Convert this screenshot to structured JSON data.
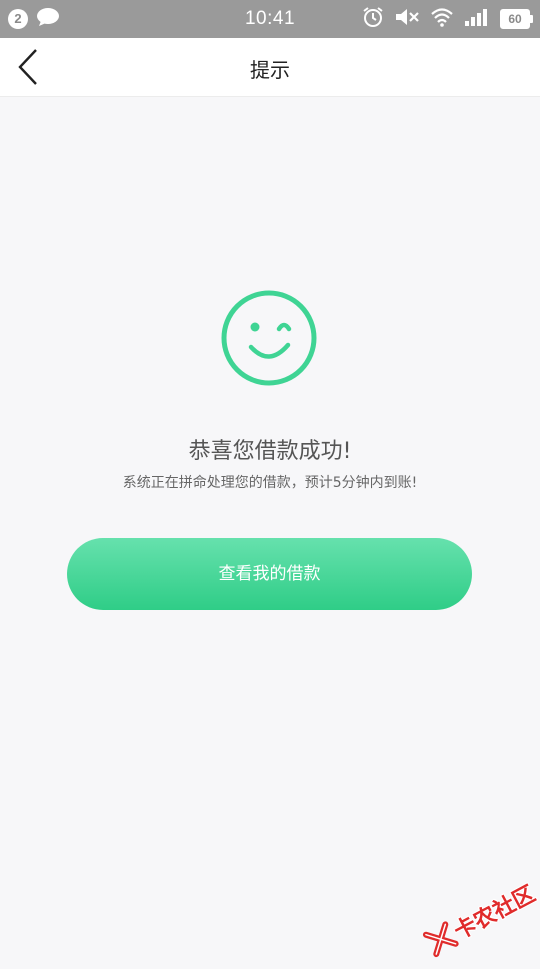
{
  "status_bar": {
    "notification_count": "2",
    "time": "10:41",
    "battery_level": "60"
  },
  "nav": {
    "title": "提示",
    "back_icon": "chevron-left-icon"
  },
  "content": {
    "icon": "wink-smiley-icon",
    "title": "恭喜您借款成功!",
    "subtitle": "系统正在拼命处理您的借款，预计5分钟内到账!",
    "button_label": "查看我的借款"
  },
  "watermark": {
    "text": "卡农社区"
  },
  "colors": {
    "accent": "#3fd494",
    "status_bar": "#9a9a9a",
    "background": "#f7f7f9",
    "watermark": "#e02b2b"
  }
}
